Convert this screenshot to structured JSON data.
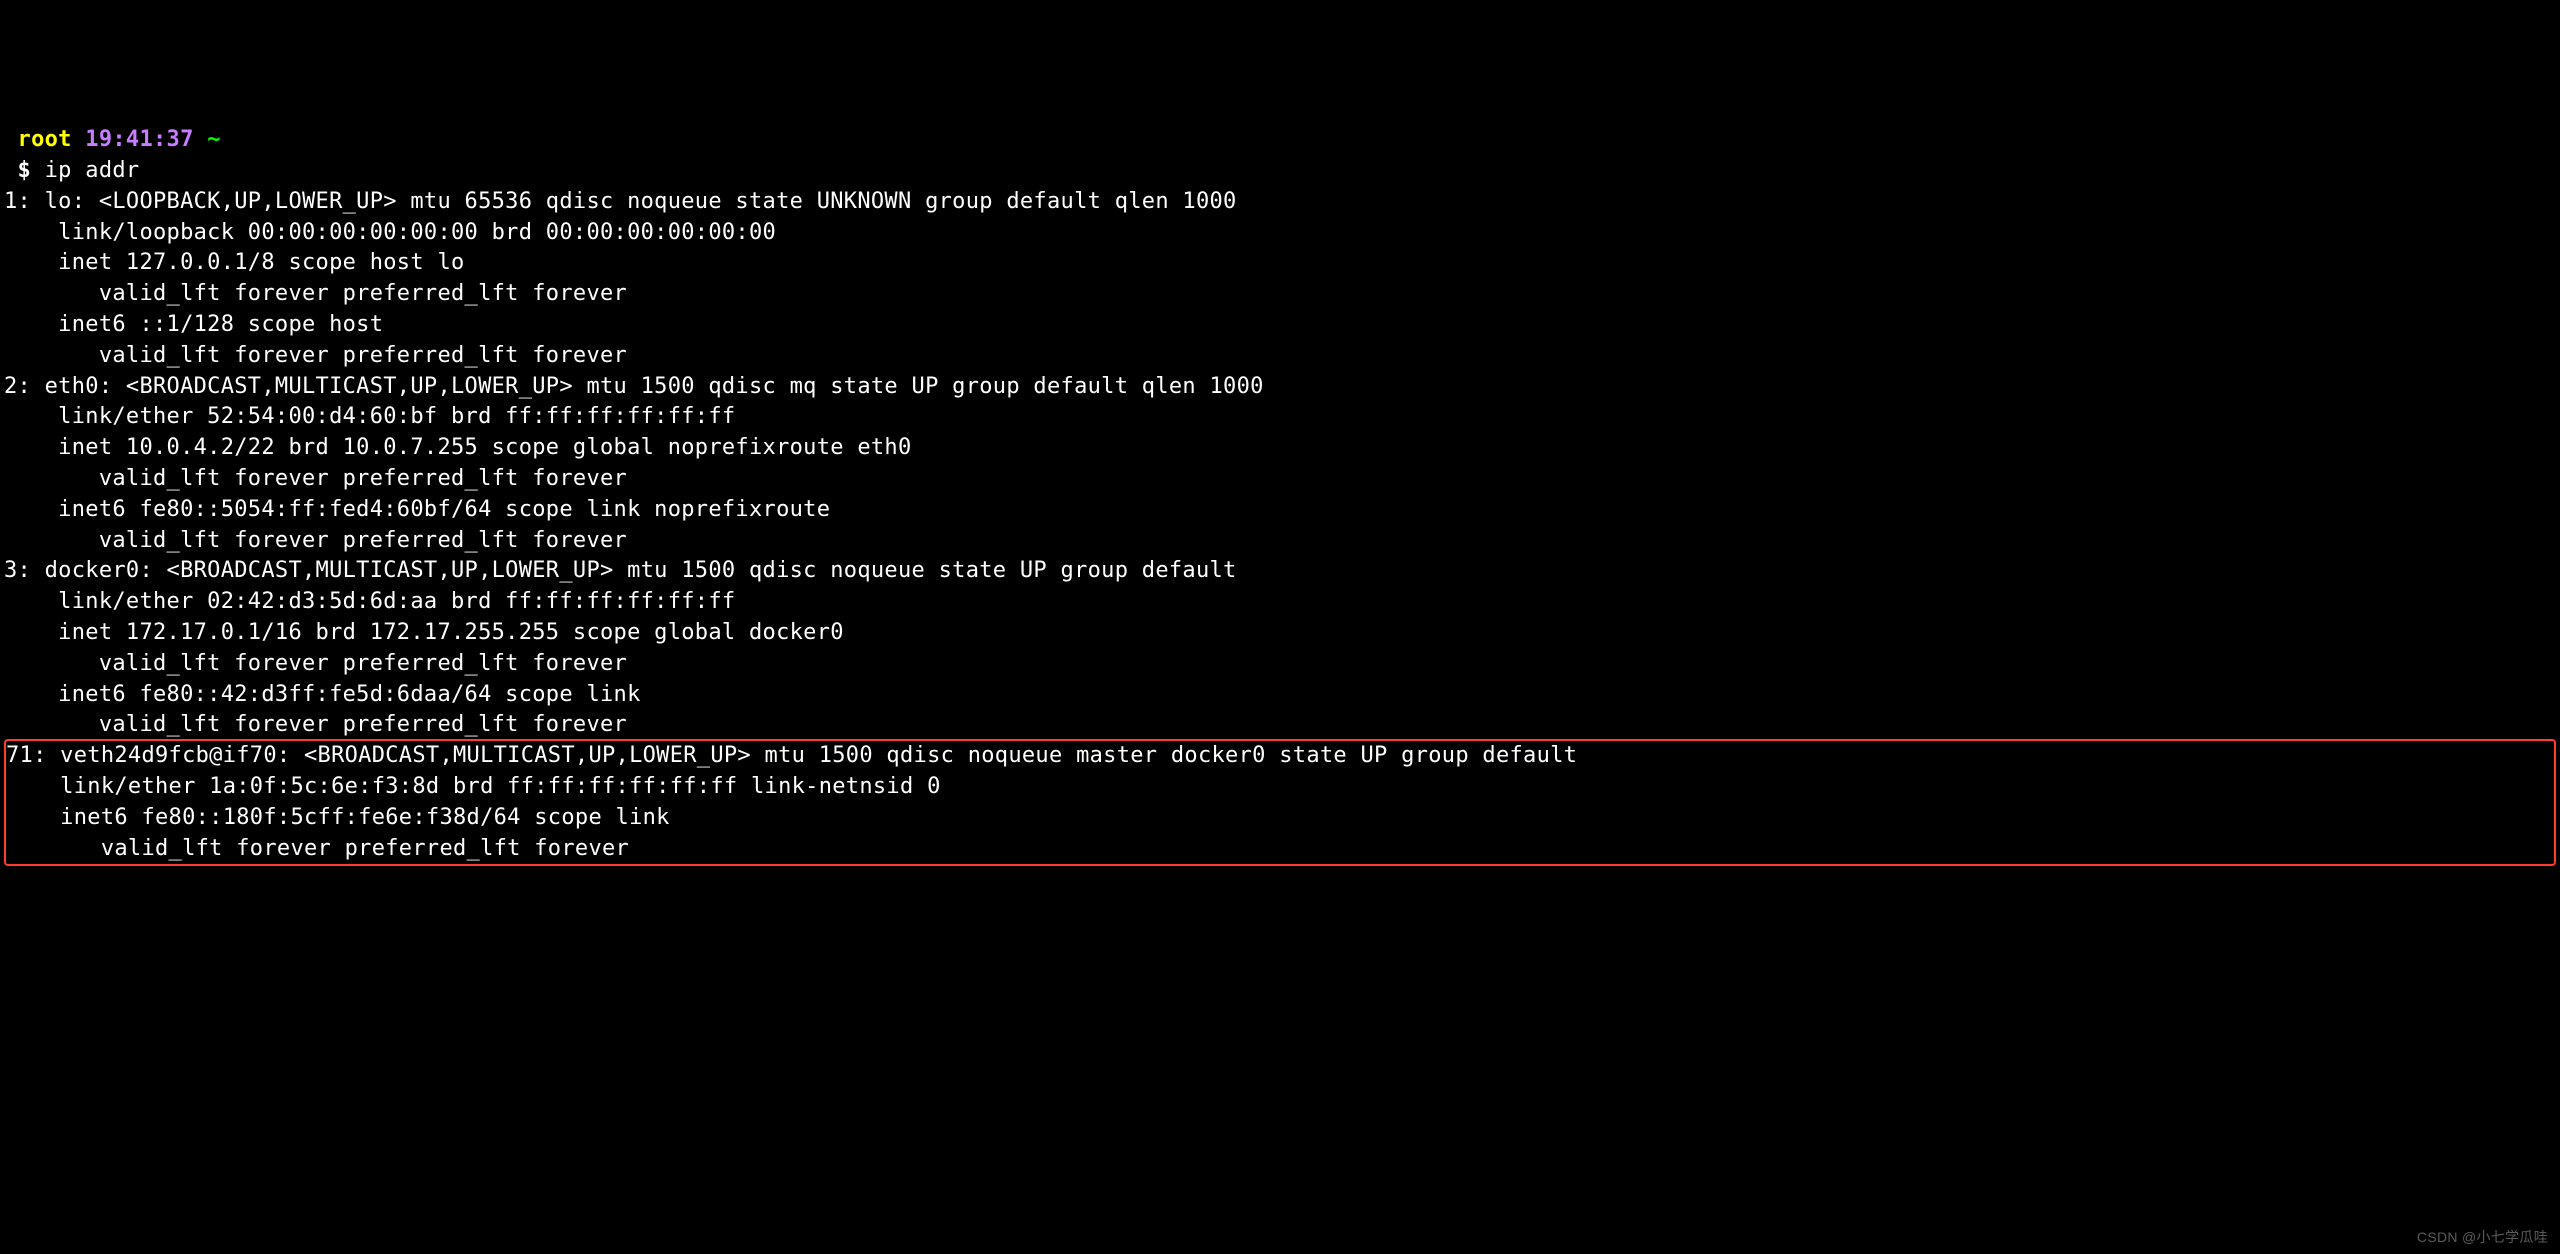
{
  "prompt": {
    "user": " root",
    "time": "19:41:37",
    "path": "~",
    "symbol": " $",
    "cmd": " ip addr"
  },
  "lines": {
    "l01": "1: lo: <LOOPBACK,UP,LOWER_UP> mtu 65536 qdisc noqueue state UNKNOWN group default qlen 1000",
    "l02": "    link/loopback 00:00:00:00:00:00 brd 00:00:00:00:00:00",
    "l03": "    inet 127.0.0.1/8 scope host lo",
    "l04": "       valid_lft forever preferred_lft forever",
    "l05": "    inet6 ::1/128 scope host ",
    "l06": "       valid_lft forever preferred_lft forever",
    "l07": "2: eth0: <BROADCAST,MULTICAST,UP,LOWER_UP> mtu 1500 qdisc mq state UP group default qlen 1000",
    "l08": "    link/ether 52:54:00:d4:60:bf brd ff:ff:ff:ff:ff:ff",
    "l09": "    inet 10.0.4.2/22 brd 10.0.7.255 scope global noprefixroute eth0",
    "l10": "       valid_lft forever preferred_lft forever",
    "l11": "    inet6 fe80::5054:ff:fed4:60bf/64 scope link noprefixroute ",
    "l12": "       valid_lft forever preferred_lft forever",
    "l13": "3: docker0: <BROADCAST,MULTICAST,UP,LOWER_UP> mtu 1500 qdisc noqueue state UP group default ",
    "l14": "    link/ether 02:42:d3:5d:6d:aa brd ff:ff:ff:ff:ff:ff",
    "l15": "    inet 172.17.0.1/16 brd 172.17.255.255 scope global docker0",
    "l16": "       valid_lft forever preferred_lft forever",
    "l17": "    inet6 fe80::42:d3ff:fe5d:6daa/64 scope link ",
    "l18": "       valid_lft forever preferred_lft forever",
    "h01": "71: veth24d9fcb@if70: <BROADCAST,MULTICAST,UP,LOWER_UP> mtu 1500 qdisc noqueue master docker0 state UP group default ",
    "h02": "    link/ether 1a:0f:5c:6e:f3:8d brd ff:ff:ff:ff:ff:ff link-netnsid 0",
    "h03": "    inet6 fe80::180f:5cff:fe6e:f38d/64 scope link ",
    "h04": "       valid_lft forever preferred_lft forever"
  },
  "watermark": "CSDN @小七学瓜哇"
}
